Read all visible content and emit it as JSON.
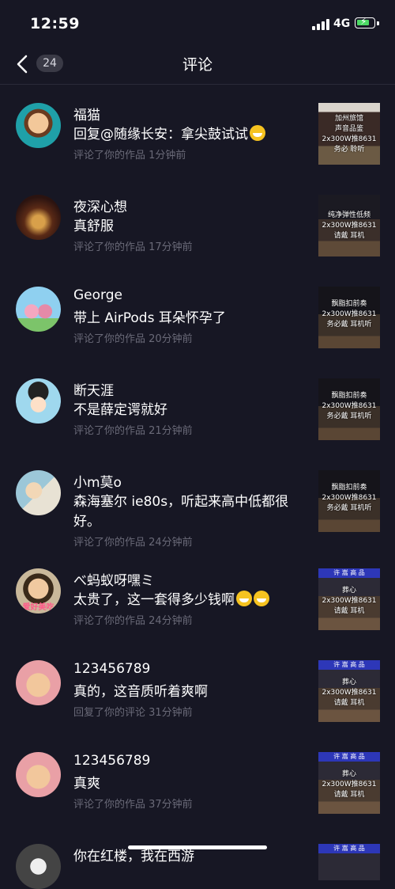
{
  "status": {
    "time": "12:59",
    "network": "4G"
  },
  "header": {
    "back_count": "24",
    "title": "评论"
  },
  "comments": [
    {
      "name": "福猫",
      "text": "回复@随缘长安：拿尖鼓试试",
      "emoji": "grin",
      "meta": "评论了你的作品  1分钟前",
      "thumb_text": "加州旅馆\n声音品鉴\n2x300W推8631\n务必  聆听",
      "thumb_banner": ""
    },
    {
      "name": "夜深心想",
      "text": "真舒服",
      "emoji": "",
      "meta": "评论了你的作品  17分钟前",
      "thumb_text": "纯净弹性低频\n2x300W推8631\n请戴  耳机",
      "thumb_banner": ""
    },
    {
      "name": "George",
      "text": "带上 AirPods 耳朵怀孕了",
      "emoji": "",
      "meta": "评论了你的作品  20分钟前",
      "thumb_text": "飘脂扣前奏\n2x300W推8631\n务必戴  耳机听",
      "thumb_banner": ""
    },
    {
      "name": "断天涯",
      "text": "不是薛定谔就好",
      "emoji": "",
      "meta": "评论了你的作品  21分钟前",
      "thumb_text": "飘脂扣前奏\n2x300W推8631\n务必戴  耳机听",
      "thumb_banner": ""
    },
    {
      "name": "小m莫o",
      "text": "森海塞尔 ie80s，听起来高中低都很好。",
      "emoji": "",
      "meta": "评论了你的作品  24分钟前",
      "thumb_text": "飘脂扣前奏\n2x300W推8631\n务必戴  耳机听",
      "thumb_banner": ""
    },
    {
      "name": "べ蚂蚁呀嘿ミ",
      "text": "太贵了，这一套得多少钱啊",
      "emoji": "laugh-cry",
      "meta": "评论了你的作品  24分钟前",
      "thumb_text": "葬心\n2x300W推8631\n请戴  耳机",
      "thumb_banner": "许 嵩 高 品"
    },
    {
      "name": "123456789",
      "text": "真的，这音质听着爽啊",
      "emoji": "",
      "meta": "回复了你的评论  31分钟前",
      "thumb_text": "葬心\n2x300W推8631\n请戴  耳机",
      "thumb_banner": "许 嵩 高 品"
    },
    {
      "name": "123456789",
      "text": "真爽",
      "emoji": "",
      "meta": "评论了你的作品  37分钟前",
      "thumb_text": "葬心\n2x300W推8631\n请戴  耳机",
      "thumb_banner": "许 嵩 高 品"
    },
    {
      "name": "你在红楼，我在西游",
      "text": "",
      "emoji": "",
      "meta": "",
      "thumb_text": "",
      "thumb_banner": "许 嵩 高 品"
    }
  ],
  "avatar_labels": {
    "row5": "爱好美吃"
  },
  "colors": {
    "background": "#171724",
    "meta": "#6a6a78",
    "accent_green": "#4cd964"
  }
}
